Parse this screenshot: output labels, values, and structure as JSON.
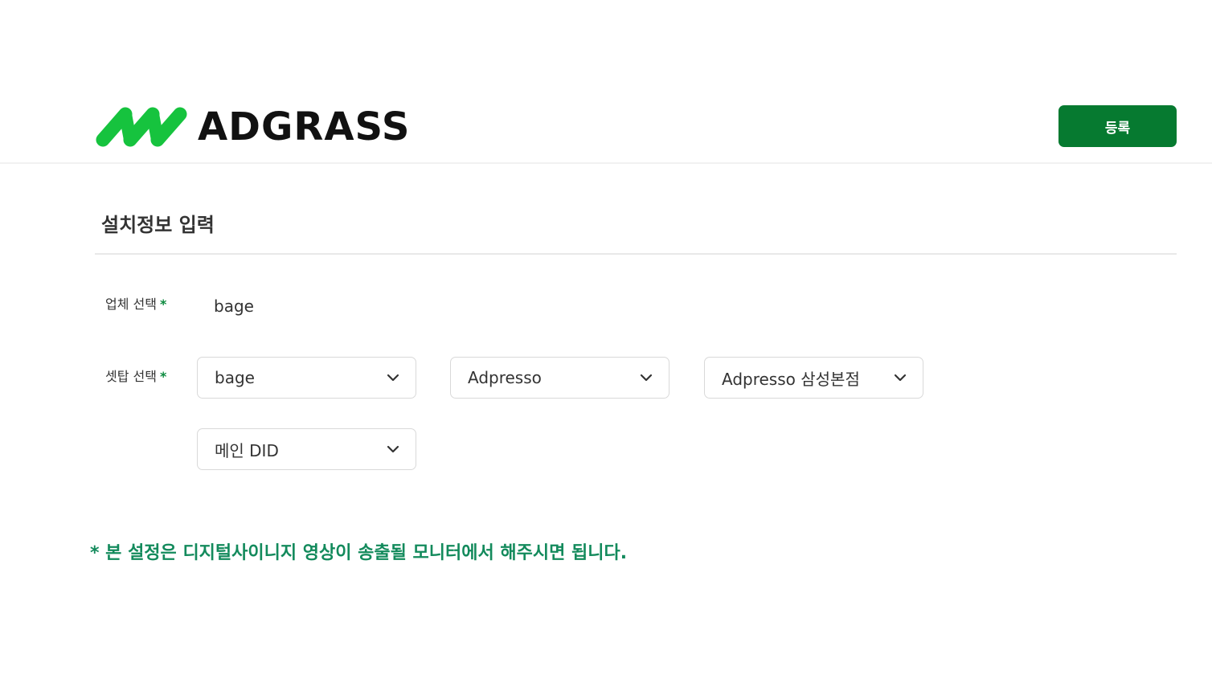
{
  "header": {
    "brand_name": "ADGRASS",
    "logo_icon": "adgrass-leaf-logo-icon",
    "register_label": "등록",
    "colors": {
      "brand_green": "#16c33e",
      "button_green": "#067a30"
    }
  },
  "section": {
    "title": "설치정보 입력"
  },
  "form": {
    "company": {
      "label": "업체 선택",
      "required_mark": "*",
      "value": "bage"
    },
    "settop": {
      "label": "셋탑 선택",
      "required_mark": "*",
      "selects": [
        {
          "value": "bage",
          "icon": "chevron-down-icon"
        },
        {
          "value": "Adpresso",
          "icon": "chevron-down-icon"
        },
        {
          "value": "Adpresso 삼성본점",
          "icon": "chevron-down-icon"
        },
        {
          "value": "메인 DID",
          "icon": "chevron-down-icon"
        }
      ]
    }
  },
  "notice": {
    "text": "* 본 설정은 디지털사이니지 영상이 송출될 모니터에서 해주시면 됩니다.",
    "color": "#138a5c"
  }
}
